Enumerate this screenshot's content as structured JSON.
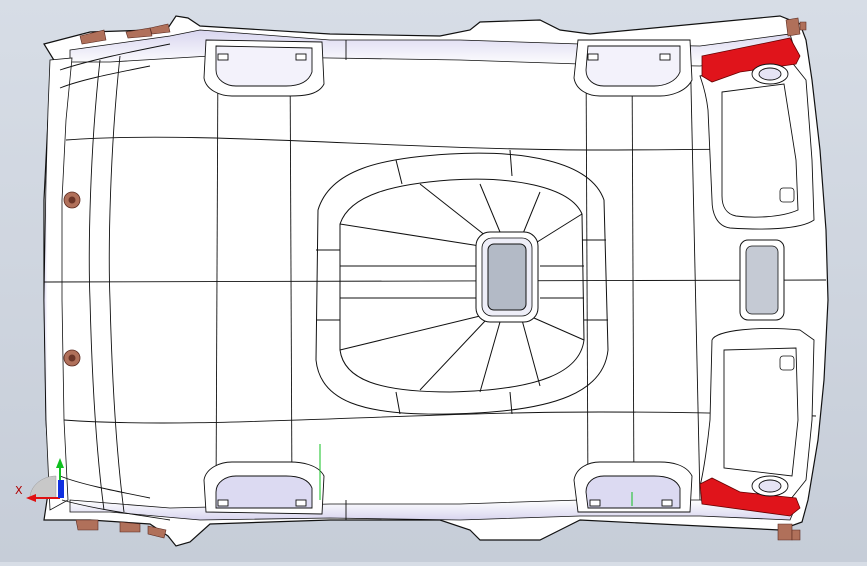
{
  "viewport": {
    "background_top": "#d7dde6",
    "background_bottom": "#c6cdd8"
  },
  "model": {
    "part": "headliner",
    "surface_color": "#ffffff",
    "shade_color": "#e9e7f6",
    "edge_color": "#111111",
    "highlight_color": "#e0141b",
    "clip_color": "#b0705a"
  },
  "triad": {
    "x_label": "X",
    "x_color": "#e01010",
    "y_color": "#10c020",
    "z_color": "#1030e0"
  }
}
